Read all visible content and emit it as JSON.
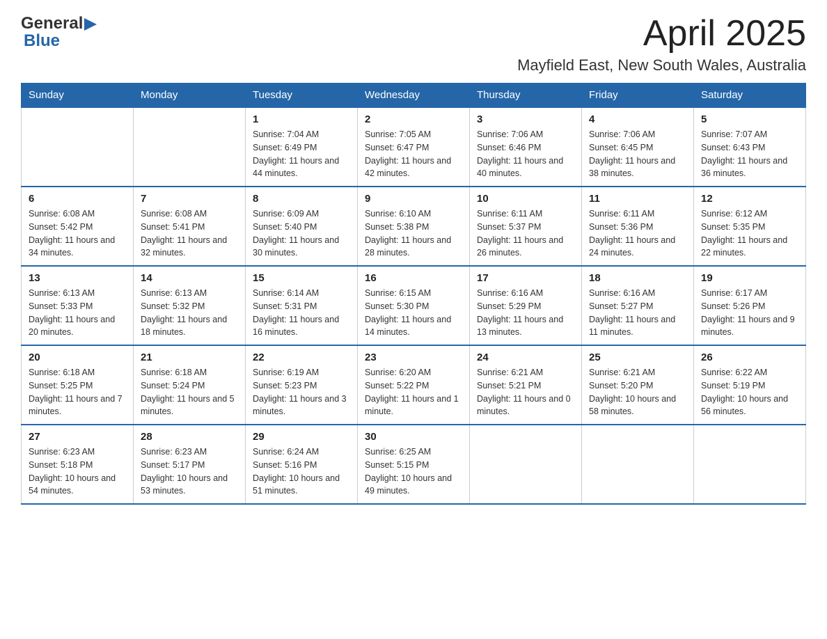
{
  "header": {
    "logo_text_general": "General",
    "logo_text_blue": "Blue",
    "month": "April 2025",
    "location": "Mayfield East, New South Wales, Australia"
  },
  "weekdays": [
    "Sunday",
    "Monday",
    "Tuesday",
    "Wednesday",
    "Thursday",
    "Friday",
    "Saturday"
  ],
  "weeks": [
    [
      {
        "day": "",
        "sunrise": "",
        "sunset": "",
        "daylight": ""
      },
      {
        "day": "",
        "sunrise": "",
        "sunset": "",
        "daylight": ""
      },
      {
        "day": "1",
        "sunrise": "Sunrise: 7:04 AM",
        "sunset": "Sunset: 6:49 PM",
        "daylight": "Daylight: 11 hours and 44 minutes."
      },
      {
        "day": "2",
        "sunrise": "Sunrise: 7:05 AM",
        "sunset": "Sunset: 6:47 PM",
        "daylight": "Daylight: 11 hours and 42 minutes."
      },
      {
        "day": "3",
        "sunrise": "Sunrise: 7:06 AM",
        "sunset": "Sunset: 6:46 PM",
        "daylight": "Daylight: 11 hours and 40 minutes."
      },
      {
        "day": "4",
        "sunrise": "Sunrise: 7:06 AM",
        "sunset": "Sunset: 6:45 PM",
        "daylight": "Daylight: 11 hours and 38 minutes."
      },
      {
        "day": "5",
        "sunrise": "Sunrise: 7:07 AM",
        "sunset": "Sunset: 6:43 PM",
        "daylight": "Daylight: 11 hours and 36 minutes."
      }
    ],
    [
      {
        "day": "6",
        "sunrise": "Sunrise: 6:08 AM",
        "sunset": "Sunset: 5:42 PM",
        "daylight": "Daylight: 11 hours and 34 minutes."
      },
      {
        "day": "7",
        "sunrise": "Sunrise: 6:08 AM",
        "sunset": "Sunset: 5:41 PM",
        "daylight": "Daylight: 11 hours and 32 minutes."
      },
      {
        "day": "8",
        "sunrise": "Sunrise: 6:09 AM",
        "sunset": "Sunset: 5:40 PM",
        "daylight": "Daylight: 11 hours and 30 minutes."
      },
      {
        "day": "9",
        "sunrise": "Sunrise: 6:10 AM",
        "sunset": "Sunset: 5:38 PM",
        "daylight": "Daylight: 11 hours and 28 minutes."
      },
      {
        "day": "10",
        "sunrise": "Sunrise: 6:11 AM",
        "sunset": "Sunset: 5:37 PM",
        "daylight": "Daylight: 11 hours and 26 minutes."
      },
      {
        "day": "11",
        "sunrise": "Sunrise: 6:11 AM",
        "sunset": "Sunset: 5:36 PM",
        "daylight": "Daylight: 11 hours and 24 minutes."
      },
      {
        "day": "12",
        "sunrise": "Sunrise: 6:12 AM",
        "sunset": "Sunset: 5:35 PM",
        "daylight": "Daylight: 11 hours and 22 minutes."
      }
    ],
    [
      {
        "day": "13",
        "sunrise": "Sunrise: 6:13 AM",
        "sunset": "Sunset: 5:33 PM",
        "daylight": "Daylight: 11 hours and 20 minutes."
      },
      {
        "day": "14",
        "sunrise": "Sunrise: 6:13 AM",
        "sunset": "Sunset: 5:32 PM",
        "daylight": "Daylight: 11 hours and 18 minutes."
      },
      {
        "day": "15",
        "sunrise": "Sunrise: 6:14 AM",
        "sunset": "Sunset: 5:31 PM",
        "daylight": "Daylight: 11 hours and 16 minutes."
      },
      {
        "day": "16",
        "sunrise": "Sunrise: 6:15 AM",
        "sunset": "Sunset: 5:30 PM",
        "daylight": "Daylight: 11 hours and 14 minutes."
      },
      {
        "day": "17",
        "sunrise": "Sunrise: 6:16 AM",
        "sunset": "Sunset: 5:29 PM",
        "daylight": "Daylight: 11 hours and 13 minutes."
      },
      {
        "day": "18",
        "sunrise": "Sunrise: 6:16 AM",
        "sunset": "Sunset: 5:27 PM",
        "daylight": "Daylight: 11 hours and 11 minutes."
      },
      {
        "day": "19",
        "sunrise": "Sunrise: 6:17 AM",
        "sunset": "Sunset: 5:26 PM",
        "daylight": "Daylight: 11 hours and 9 minutes."
      }
    ],
    [
      {
        "day": "20",
        "sunrise": "Sunrise: 6:18 AM",
        "sunset": "Sunset: 5:25 PM",
        "daylight": "Daylight: 11 hours and 7 minutes."
      },
      {
        "day": "21",
        "sunrise": "Sunrise: 6:18 AM",
        "sunset": "Sunset: 5:24 PM",
        "daylight": "Daylight: 11 hours and 5 minutes."
      },
      {
        "day": "22",
        "sunrise": "Sunrise: 6:19 AM",
        "sunset": "Sunset: 5:23 PM",
        "daylight": "Daylight: 11 hours and 3 minutes."
      },
      {
        "day": "23",
        "sunrise": "Sunrise: 6:20 AM",
        "sunset": "Sunset: 5:22 PM",
        "daylight": "Daylight: 11 hours and 1 minute."
      },
      {
        "day": "24",
        "sunrise": "Sunrise: 6:21 AM",
        "sunset": "Sunset: 5:21 PM",
        "daylight": "Daylight: 11 hours and 0 minutes."
      },
      {
        "day": "25",
        "sunrise": "Sunrise: 6:21 AM",
        "sunset": "Sunset: 5:20 PM",
        "daylight": "Daylight: 10 hours and 58 minutes."
      },
      {
        "day": "26",
        "sunrise": "Sunrise: 6:22 AM",
        "sunset": "Sunset: 5:19 PM",
        "daylight": "Daylight: 10 hours and 56 minutes."
      }
    ],
    [
      {
        "day": "27",
        "sunrise": "Sunrise: 6:23 AM",
        "sunset": "Sunset: 5:18 PM",
        "daylight": "Daylight: 10 hours and 54 minutes."
      },
      {
        "day": "28",
        "sunrise": "Sunrise: 6:23 AM",
        "sunset": "Sunset: 5:17 PM",
        "daylight": "Daylight: 10 hours and 53 minutes."
      },
      {
        "day": "29",
        "sunrise": "Sunrise: 6:24 AM",
        "sunset": "Sunset: 5:16 PM",
        "daylight": "Daylight: 10 hours and 51 minutes."
      },
      {
        "day": "30",
        "sunrise": "Sunrise: 6:25 AM",
        "sunset": "Sunset: 5:15 PM",
        "daylight": "Daylight: 10 hours and 49 minutes."
      },
      {
        "day": "",
        "sunrise": "",
        "sunset": "",
        "daylight": ""
      },
      {
        "day": "",
        "sunrise": "",
        "sunset": "",
        "daylight": ""
      },
      {
        "day": "",
        "sunrise": "",
        "sunset": "",
        "daylight": ""
      }
    ]
  ]
}
